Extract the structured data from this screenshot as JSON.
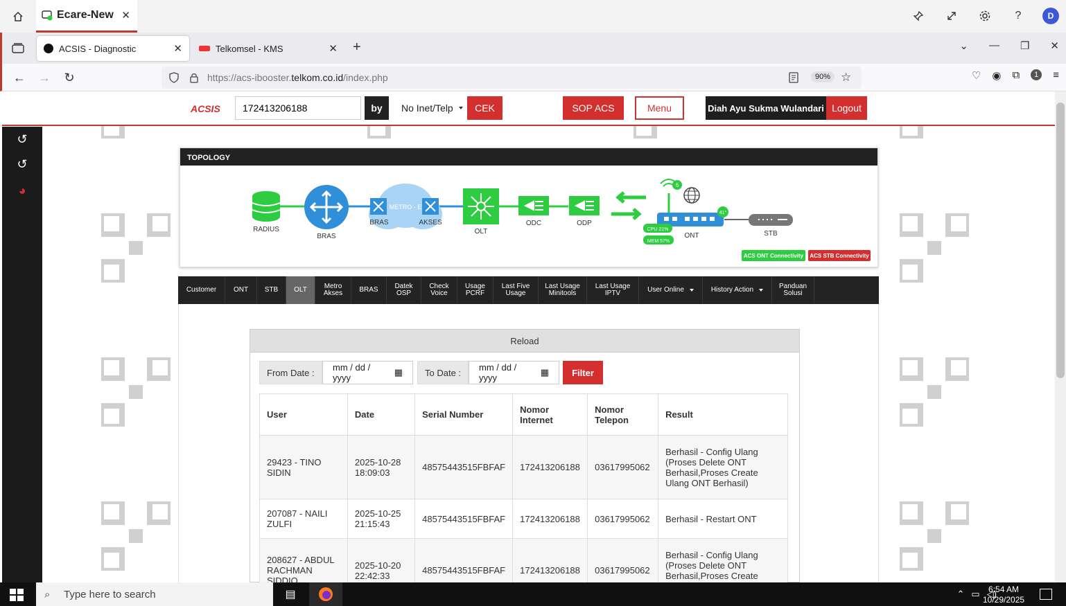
{
  "host": {
    "tab_title": "Ecare-New",
    "right_icons": [
      "pin-icon",
      "expand-icon",
      "gear-icon",
      "help-icon"
    ],
    "help_label": "?",
    "avatar_initial": "D"
  },
  "browser": {
    "tabs": [
      {
        "title": "ACSIS - Diagnostic",
        "active": true
      },
      {
        "title": "Telkomsel - KMS",
        "active": false
      }
    ],
    "url_prefix": "https://acs-ibooster.",
    "url_domain": "telkom.co.id",
    "url_suffix": "/index.php",
    "zoom": "90%",
    "extension_badge": "1"
  },
  "header": {
    "logo": "ACSIS",
    "search_value": "172413206188",
    "by_label": "by",
    "by_select": "No Inet/Telp",
    "cek_label": "CEK",
    "sop_label": "SOP ACS",
    "menu_label": "Menu",
    "user_name": "Diah Ayu Sukma Wulandari",
    "logout_label": "Logout"
  },
  "topology": {
    "title": "TOPOLOGY",
    "nodes": {
      "radius": "RADIUS",
      "bras": "BRAS",
      "bras2": "BRAS",
      "metro": "METRO - E",
      "akses": "AKSES",
      "olt": "OLT",
      "odc": "ODC",
      "odp": "ODP",
      "ont": "ONT",
      "stb": "STB"
    },
    "wifi_count": "6",
    "temperature": "41°",
    "cpu": "CPU 21%",
    "mem": "MEM 57%",
    "ont_connectivity": "ACS ONT Connectivity",
    "stb_connectivity": "ACS STB Connectivity",
    "colors": {
      "ok": "#2ecc40",
      "node_blue": "#2f8fd8",
      "node_green": "#2ecc40",
      "warn": "#d32f2f"
    }
  },
  "tabs": [
    {
      "label": "Customer"
    },
    {
      "label": "ONT"
    },
    {
      "label": "STB"
    },
    {
      "label": "OLT",
      "active": true
    },
    {
      "label": "Metro Akses"
    },
    {
      "label": "BRAS"
    },
    {
      "label": "Datek OSP"
    },
    {
      "label": "Check Voice"
    },
    {
      "label": "Usage PCRF"
    },
    {
      "label": "Last Five Usage"
    },
    {
      "label": "Last Usage Minitools"
    },
    {
      "label": "Last Usage IPTV"
    },
    {
      "label": "User Online",
      "dropdown": true
    },
    {
      "label": "History Action",
      "dropdown": true
    },
    {
      "label": "Panduan Solusi"
    }
  ],
  "history": {
    "reload_label": "Reload",
    "from_label": "From Date :",
    "to_label": "To Date :",
    "date_placeholder": "mm / dd / yyyy",
    "filter_label": "Filter",
    "columns": [
      "User",
      "Date",
      "Serial Number",
      "Nomor Internet",
      "Nomor Telepon",
      "Result"
    ],
    "rows": [
      {
        "user": "29423 - TINO SIDIN",
        "date": "2025-10-28 18:09:03",
        "serial": "48575443515FBFAF",
        "internet": "172413206188",
        "telepon": "03617995062",
        "result": "Berhasil - Config Ulang (Proses Delete ONT Berhasil,Proses Create Ulang ONT Berhasil)"
      },
      {
        "user": "207087 - NAILI ZULFI",
        "date": "2025-10-25 21:15:43",
        "serial": "48575443515FBFAF",
        "internet": "172413206188",
        "telepon": "03617995062",
        "result": "Berhasil - Restart ONT"
      },
      {
        "user": "208627 - ABDUL RACHMAN SIDDIQ",
        "date": "2025-10-20 22:42:33",
        "serial": "48575443515FBFAF",
        "internet": "172413206188",
        "telepon": "03617995062",
        "result": "Berhasil - Config Ulang (Proses Delete ONT Berhasil,Proses Create Ulang"
      }
    ]
  },
  "taskbar": {
    "search_placeholder": "Type here to search",
    "time": "6:54 AM",
    "date": "10/29/2025"
  }
}
